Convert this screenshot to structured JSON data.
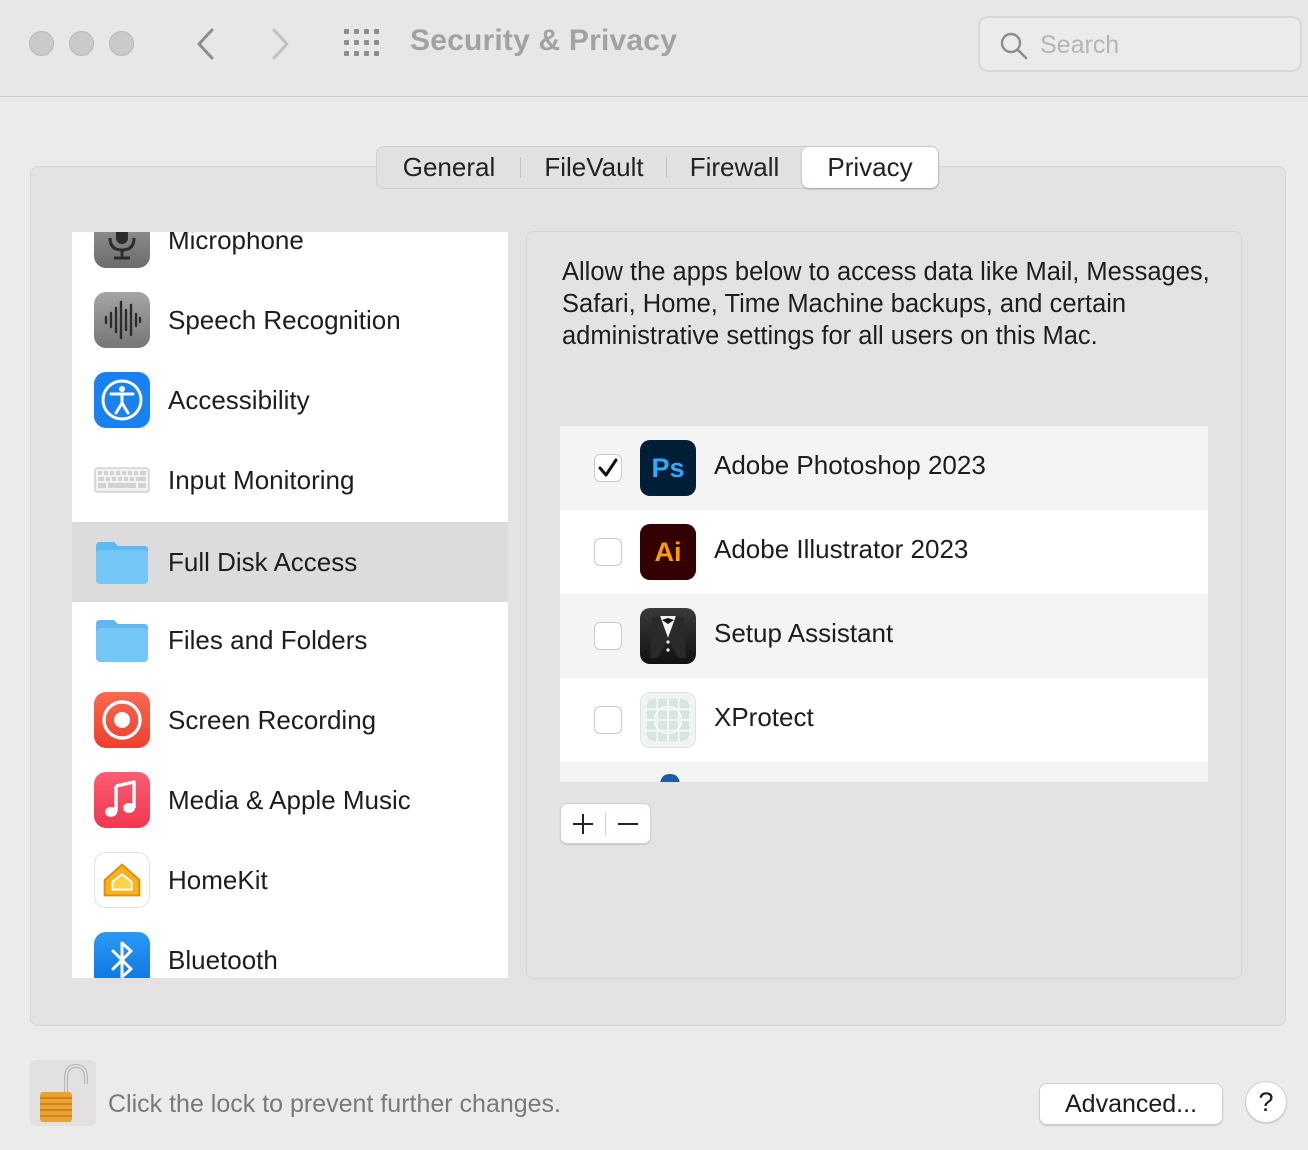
{
  "window": {
    "title": "Security & Privacy",
    "search_placeholder": "Search"
  },
  "tabs": [
    {
      "label": "General",
      "active": false
    },
    {
      "label": "FileVault",
      "active": false
    },
    {
      "label": "Firewall",
      "active": false
    },
    {
      "label": "Privacy",
      "active": true
    }
  ],
  "sidebar": {
    "selected": "Full Disk Access",
    "items": [
      {
        "label": "Microphone",
        "icon": "microphone-icon"
      },
      {
        "label": "Speech Recognition",
        "icon": "waveform-icon"
      },
      {
        "label": "Accessibility",
        "icon": "accessibility-icon"
      },
      {
        "label": "Input Monitoring",
        "icon": "keyboard-icon"
      },
      {
        "label": "Full Disk Access",
        "icon": "folder-icon"
      },
      {
        "label": "Files and Folders",
        "icon": "folder-icon"
      },
      {
        "label": "Screen Recording",
        "icon": "screen-recording-icon"
      },
      {
        "label": "Media & Apple Music",
        "icon": "music-note-icon"
      },
      {
        "label": "HomeKit",
        "icon": "home-icon"
      },
      {
        "label": "Bluetooth",
        "icon": "bluetooth-icon"
      }
    ]
  },
  "detail": {
    "description": "Allow the apps below to access data like Mail, Messages, Safari, Home, Time Machine backups, and certain administrative settings for all users on this Mac.",
    "apps": [
      {
        "name": "Adobe Photoshop 2023",
        "checked": true,
        "icon": "photoshop-icon",
        "icon_text": "Ps"
      },
      {
        "name": "Adobe Illustrator 2023",
        "checked": false,
        "icon": "illustrator-icon",
        "icon_text": "Ai"
      },
      {
        "name": "Setup Assistant",
        "checked": false,
        "icon": "tuxedo-icon"
      },
      {
        "name": "XProtect",
        "checked": false,
        "icon": "xprotect-icon"
      }
    ],
    "add_label": "+",
    "remove_label": "−"
  },
  "footer": {
    "lock_text": "Click the lock to prevent further changes.",
    "advanced_label": "Advanced...",
    "help_label": "?"
  },
  "colors": {
    "window_bg": "#ecebeb",
    "selected_row": "#dcdcdc",
    "photoshop_bg": "#001e36",
    "photoshop_fg": "#31a8ff",
    "illustrator_bg": "#330000",
    "illustrator_fg": "#ff9a00"
  }
}
